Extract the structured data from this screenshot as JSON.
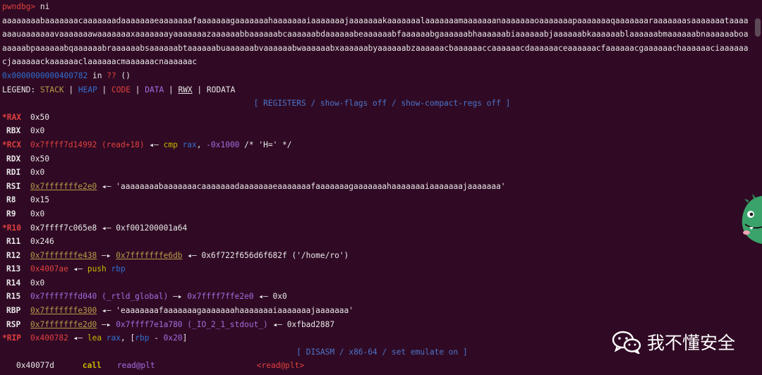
{
  "prompt": "pwndbg>",
  "command": "ni",
  "pattern_output": "aaaaaaaabaaaaaaacaaaaaaadaaaaaaaeaaaaaaafaaaaaaagaaaaaaahaaaaaaaiaaaaaaajaaaaaaakaaaaaaalaaaaaaamaaaaaaanaaaaaaaoaaaaaaapaaaaaaaqaaaaaaaraaaaaaasaaaaaaataaaaaaauaaaaaaavaaaaaaawaaaaaaaxaaaaaaayaaaaaaazaaaaaabbaaaaaabcaaaaaabdaaaaaabeaaaaaabfaaaaaabgaaaaaabhaaaaaabiaaaaaabjaaaaaabkaaaaaablaaaaaabmaaaaaabnaaaaaaboaaaaaabpaaaaaabqaaaaaabraaaaaabsaaaaaabtaaaaaabuaaaaaabvaaaaaabwaaaaaabxaaaaaabyaaaaaabzaaaaaacbaaaaaaccaaaaaacdaaaaaaceaaaaaacfaaaaaacgaaaaaachaaaaaaciaaaaaacjaaaaaackaaaaaaclaaaaaacmaaaaaacnaaaaaac",
  "location": {
    "address": "0x0000000000400782",
    "in_text": "in",
    "function": "??",
    "parens": "()"
  },
  "legend": {
    "label": "LEGEND:",
    "items": [
      "STACK",
      "HEAP",
      "CODE",
      "DATA",
      "RWX",
      "RODATA"
    ],
    "separator": "|"
  },
  "registers_header": "[ REGISTERS / show-flags off / show-compact-regs off ]",
  "registers": [
    {
      "name": "*RAX",
      "modified": true,
      "parts": [
        {
          "t": "0x50",
          "c": "white"
        }
      ]
    },
    {
      "name": "RBX",
      "modified": false,
      "parts": [
        {
          "t": "0x0",
          "c": "white"
        }
      ]
    },
    {
      "name": "*RCX",
      "modified": true,
      "parts": [
        {
          "t": "0x7ffff7d14992 (read+18)",
          "c": "red"
        },
        {
          "t": " ◂— ",
          "c": "white"
        },
        {
          "t": "cmp",
          "c": "yellow"
        },
        {
          "t": " rax",
          "c": "blue"
        },
        {
          "t": ", ",
          "c": "white"
        },
        {
          "t": "-0x1000",
          "c": "purple"
        },
        {
          "t": " /* 'H=' */",
          "c": "white"
        }
      ]
    },
    {
      "name": "RDX",
      "modified": false,
      "parts": [
        {
          "t": "0x50",
          "c": "white"
        }
      ]
    },
    {
      "name": "RDI",
      "modified": false,
      "parts": [
        {
          "t": "0x0",
          "c": "white"
        }
      ]
    },
    {
      "name": "RSI",
      "modified": false,
      "parts": [
        {
          "t": "0x7fffffffe2e0",
          "c": "olive-u"
        },
        {
          "t": " ◂— 'aaaaaaaabaaaaaaacaaaaaaadaaaaaaaeaaaaaaafaaaaaaagaaaaaaahaaaaaaaiaaaaaaajaaaaaaa'",
          "c": "white"
        }
      ]
    },
    {
      "name": "R8",
      "modified": false,
      "parts": [
        {
          "t": "0x15",
          "c": "white"
        }
      ]
    },
    {
      "name": "R9",
      "modified": false,
      "parts": [
        {
          "t": "0x0",
          "c": "white"
        }
      ]
    },
    {
      "name": "*R10",
      "modified": true,
      "parts": [
        {
          "t": "0x7ffff7c065e8",
          "c": "white"
        },
        {
          "t": " ◂— 0xf001200001a64",
          "c": "white"
        }
      ]
    },
    {
      "name": "R11",
      "modified": false,
      "parts": [
        {
          "t": "0x246",
          "c": "white"
        }
      ]
    },
    {
      "name": "R12",
      "modified": false,
      "parts": [
        {
          "t": "0x7fffffffe438",
          "c": "olive-u"
        },
        {
          "t": " —▸ ",
          "c": "white"
        },
        {
          "t": "0x7fffffffe6db",
          "c": "olive-u"
        },
        {
          "t": " ◂— 0x6f722f656d6f682f ('/home/ro')",
          "c": "white"
        }
      ]
    },
    {
      "name": "R13",
      "modified": false,
      "parts": [
        {
          "t": "0x4007ae",
          "c": "red"
        },
        {
          "t": " ◂— ",
          "c": "white"
        },
        {
          "t": "push",
          "c": "yellow"
        },
        {
          "t": " rbp",
          "c": "blue"
        }
      ]
    },
    {
      "name": "R14",
      "modified": false,
      "parts": [
        {
          "t": "0x0",
          "c": "white"
        }
      ]
    },
    {
      "name": "R15",
      "modified": false,
      "parts": [
        {
          "t": "0x7ffff7ffd040 (_rtld_global)",
          "c": "purple"
        },
        {
          "t": " —▸ ",
          "c": "white"
        },
        {
          "t": "0x7ffff7ffe2e0",
          "c": "purple"
        },
        {
          "t": " ◂— 0x0",
          "c": "white"
        }
      ]
    },
    {
      "name": "RBP",
      "modified": false,
      "parts": [
        {
          "t": "0x7fffffffe300",
          "c": "olive-u"
        },
        {
          "t": " ◂— 'eaaaaaaafaaaaaaagaaaaaaahaaaaaaaiaaaaaaajaaaaaaa'",
          "c": "white"
        }
      ]
    },
    {
      "name": "RSP",
      "modified": false,
      "parts": [
        {
          "t": "0x7fffffffe2d0",
          "c": "olive-u"
        },
        {
          "t": " —▸ ",
          "c": "white"
        },
        {
          "t": "0x7ffff7e1a780 (_IO_2_1_stdout_)",
          "c": "purple"
        },
        {
          "t": " ◂— 0xfbad2887",
          "c": "white"
        }
      ]
    },
    {
      "name": "*RIP",
      "modified": true,
      "parts": [
        {
          "t": "0x400782",
          "c": "red"
        },
        {
          "t": " ◂— ",
          "c": "white"
        },
        {
          "t": "lea",
          "c": "yellow"
        },
        {
          "t": " rax",
          "c": "blue"
        },
        {
          "t": ", [",
          "c": "white"
        },
        {
          "t": "rbp",
          "c": "blue"
        },
        {
          "t": " - ",
          "c": "white"
        },
        {
          "t": "0x20",
          "c": "purple"
        },
        {
          "t": "]",
          "c": "white"
        }
      ]
    }
  ],
  "disasm_header": "[ DISASM / x86-64 / set emulate on ]",
  "disasm": [
    {
      "addr": "0x40077d",
      "mnemonic": "call",
      "operand": "read@plt",
      "target": "<read@plt>"
    }
  ],
  "watermark": "我不懂安全",
  "colors": {
    "background": "#300a24",
    "stack": "#b79b49",
    "heap": "#2f6fd1",
    "code": "#e0403f",
    "data": "#a46be0",
    "instruction": "#c9b800",
    "register": "#2f6fd1",
    "prompt": "#e0403f"
  }
}
